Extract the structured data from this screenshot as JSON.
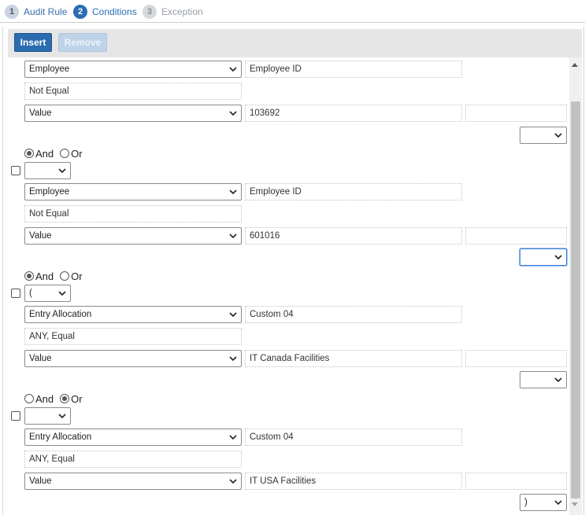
{
  "steps": [
    {
      "num": "1",
      "label": "Audit Rule"
    },
    {
      "num": "2",
      "label": "Conditions"
    },
    {
      "num": "3",
      "label": "Exception"
    }
  ],
  "toolbar": {
    "insert_label": "Insert",
    "remove_label": "Remove"
  },
  "logic_labels": {
    "and": "And",
    "or": "Or"
  },
  "conditions": [
    {
      "open_paren": "",
      "field_type": "Employee",
      "field_name": "Employee ID",
      "operator": "Not Equal",
      "value_type": "Value",
      "value": "103692",
      "value2": "",
      "close_paren": "",
      "logic": null
    },
    {
      "open_paren": "",
      "field_type": "Employee",
      "field_name": "Employee ID",
      "operator": "Not Equal",
      "value_type": "Value",
      "value": "601016",
      "value2": "",
      "close_paren": "",
      "logic": "And"
    },
    {
      "open_paren": "(",
      "field_type": "Entry Allocation",
      "field_name": "Custom 04",
      "operator": "ANY, Equal",
      "value_type": "Value",
      "value": "IT Canada Facilities",
      "value2": "",
      "close_paren": "",
      "logic": "And"
    },
    {
      "open_paren": "",
      "field_type": "Entry Allocation",
      "field_name": "Custom 04",
      "operator": "ANY, Equal",
      "value_type": "Value",
      "value": "IT USA Facilities",
      "value2": "",
      "close_paren": ")",
      "logic": "Or"
    }
  ],
  "colors": {
    "primary": "#2b6cb0",
    "active_step": "#2a6fb3",
    "toolbar_bg": "#e6e6e6",
    "focus": "#3b7dd8"
  },
  "icons": {
    "dropdown": "chevron-down-icon",
    "scroll_up": "scroll-up-arrow-icon",
    "scroll_down": "scroll-down-arrow-icon"
  }
}
